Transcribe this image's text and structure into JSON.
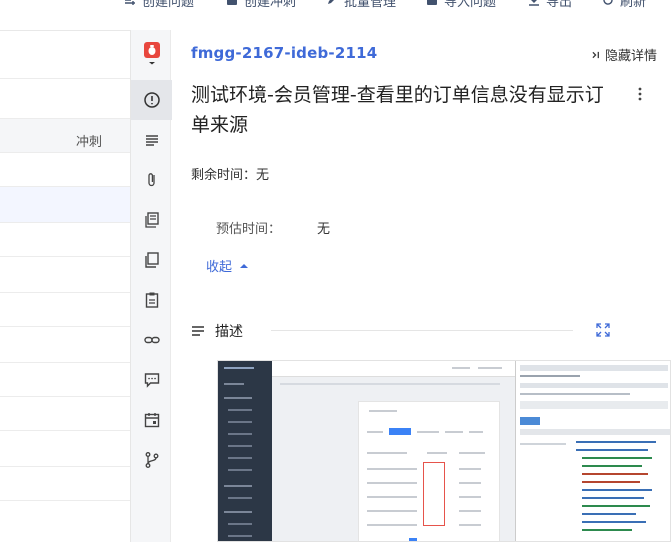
{
  "toolbar": {
    "items": [
      {
        "label": "创建问题",
        "icon": "plus-list-icon"
      },
      {
        "label": "创建冲刺",
        "icon": "sprint-icon"
      },
      {
        "label": "批量管理",
        "icon": "pencil-icon"
      },
      {
        "label": "导入问题",
        "icon": "upload-icon"
      },
      {
        "label": "导出",
        "icon": "download-icon"
      },
      {
        "label": "刷新",
        "icon": "refresh-icon"
      }
    ]
  },
  "list": {
    "column_header": "冲刺"
  },
  "rail": {
    "items": [
      "bug-type-icon",
      "info-circle-icon",
      "list-lines-icon",
      "paperclip-icon",
      "docs-icon",
      "copy-icon",
      "clipboard-icon",
      "link-icon",
      "comment-icon",
      "calendar-icon",
      "branch-icon"
    ]
  },
  "detail": {
    "issue_key": "fmgg-2167-ideb-2114",
    "hide_detail": "隐藏详情",
    "title": "测试环境-会员管理-查看里的订单信息没有显示订单来源",
    "remaining_time": "剩余时间：无",
    "estimate_label": "预估时间：",
    "estimate_value": "无",
    "collapse_label": "收起",
    "description_label": "描述"
  },
  "colors": {
    "accent": "#3f6ad8",
    "bug_red": "#e8473e"
  }
}
